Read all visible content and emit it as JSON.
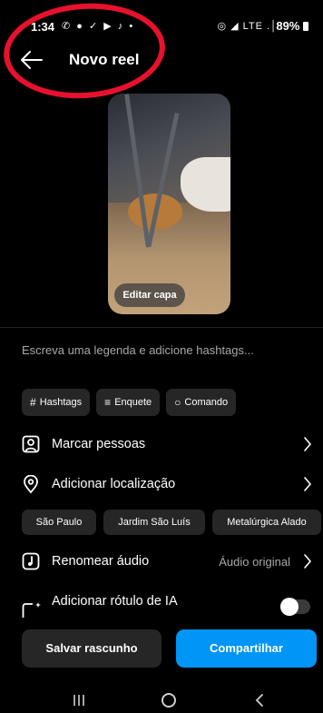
{
  "status": {
    "time": "1:34",
    "left_icons": "✆ ● ✓ ▶ ♪ •",
    "right_icons": "◎ ◢ LTE .│",
    "battery": "89%"
  },
  "header": {
    "title": "Novo reel",
    "back_icon": "arrow-left-icon"
  },
  "cover": {
    "edit_label": "Editar capa"
  },
  "caption": {
    "placeholder": "Escreva uma legenda e adicione hashtags..."
  },
  "chips": [
    {
      "icon": "#",
      "label": "Hashtags"
    },
    {
      "icon": "≡",
      "label": "Enquete"
    },
    {
      "icon": "○",
      "label": "Comando"
    }
  ],
  "rows": {
    "tag_people": "Marcar pessoas",
    "add_location": "Adicionar localização",
    "rename_audio": "Renomear áudio",
    "audio_value": "Áudio original",
    "ai_label": "Adicionar rótulo de IA",
    "ai_toggle_on": false
  },
  "locations": [
    "São Paulo",
    "Jardim São Luís",
    "Metalúrgica Alado"
  ],
  "actions": {
    "draft": "Salvar rascunho",
    "share": "Compartilhar"
  },
  "colors": {
    "accent": "#0095f6",
    "annotation": "#e8112d",
    "chip_bg": "#262626"
  }
}
